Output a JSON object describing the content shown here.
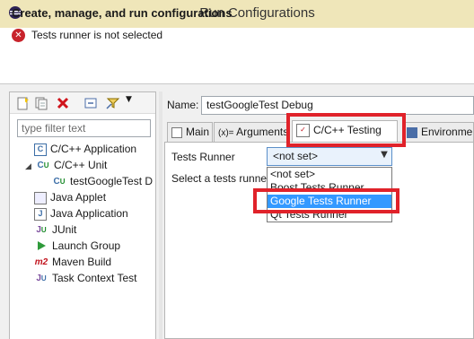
{
  "window": {
    "title": "Run Configurations"
  },
  "header": {
    "title": "Create, manage, and run configurations",
    "error_text": "Tests runner is not selected"
  },
  "left_panel": {
    "toolbar_icons": [
      "new-config-icon",
      "duplicate-icon",
      "delete-icon",
      "collapse-all-icon",
      "filter-icon",
      "dropdown-arrow-icon"
    ],
    "filter_placeholder": "type filter text",
    "tree": [
      {
        "label": "C/C++ Application",
        "icon": "c-application-icon",
        "level": 0
      },
      {
        "label": "C/C++ Unit",
        "icon": "c-unit-icon",
        "level": 0,
        "expanded": true
      },
      {
        "label": "testGoogleTest D",
        "icon": "c-unit-test-icon",
        "level": 1
      },
      {
        "label": "Java Applet",
        "icon": "java-applet-icon",
        "level": 0
      },
      {
        "label": "Java Application",
        "icon": "java-application-icon",
        "level": 0
      },
      {
        "label": "JUnit",
        "icon": "junit-icon",
        "level": 0
      },
      {
        "label": "Launch Group",
        "icon": "launch-group-icon",
        "level": 0
      },
      {
        "label": "Maven Build",
        "icon": "maven-icon",
        "level": 0
      },
      {
        "label": "Task Context Test",
        "icon": "task-context-icon",
        "level": 0
      }
    ]
  },
  "right_panel": {
    "name_label": "Name:",
    "name_value": "testGoogleTest Debug",
    "tabs": [
      {
        "label": "Main",
        "icon": "main-tab-icon"
      },
      {
        "label": "Arguments",
        "icon": "arguments-icon"
      },
      {
        "label": "C/C++ Testing",
        "icon": "c-testing-icon",
        "active": true
      },
      {
        "label": "Environment",
        "icon": "environment-icon"
      }
    ],
    "tests_runner_label": "Tests Runner",
    "tests_runner_value": "<not set>",
    "description": "Select a tests runner...",
    "dropdown_options": [
      "<not set>",
      "Boost Tests Runner",
      "Google Tests Runner",
      "Qt Tests Runner"
    ],
    "dropdown_highlighted": "Google Tests Runner"
  },
  "colors": {
    "titlebar": "#efe6b9",
    "highlight_box": "#e0222a",
    "selection": "#3399ff",
    "error": "#c8232b"
  }
}
